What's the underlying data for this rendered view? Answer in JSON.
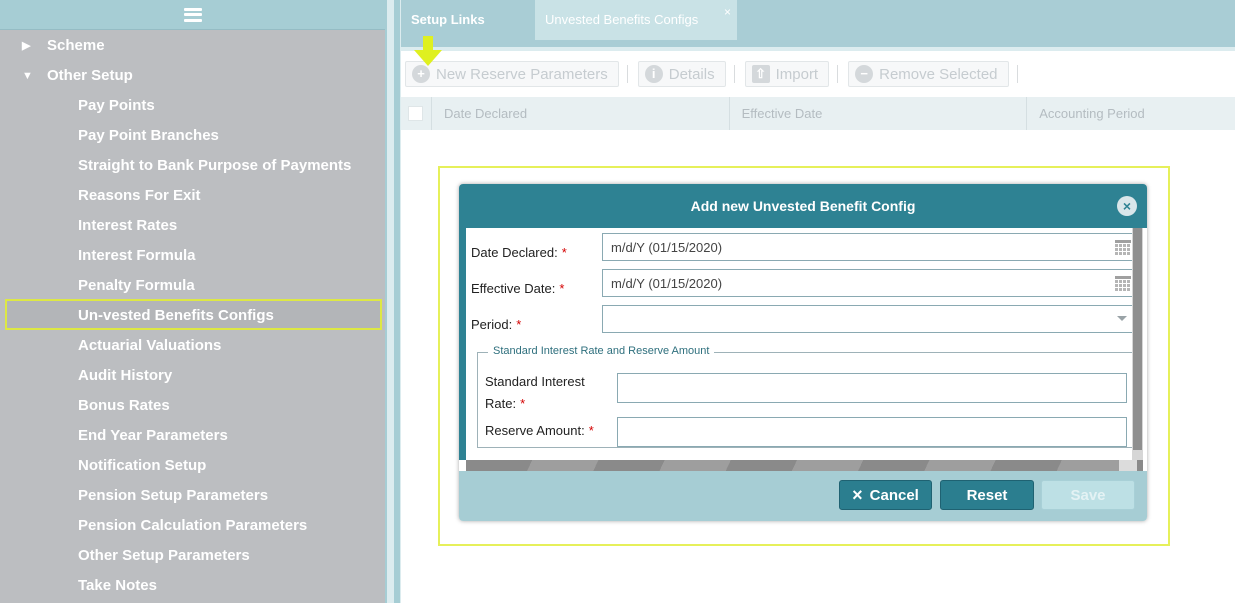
{
  "sidebar": {
    "groups": [
      {
        "label": "Scheme",
        "expanded": false
      },
      {
        "label": "Other Setup",
        "expanded": true
      }
    ],
    "items": [
      "Pay Points",
      "Pay Point Branches",
      "Straight to Bank Purpose of Payments",
      "Reasons For Exit",
      "Interest Rates",
      "Interest Formula",
      "Penalty Formula",
      "Un-vested Benefits Configs",
      "Actuarial Valuations",
      "Audit History",
      "Bonus Rates",
      "End Year Parameters",
      "Notification Setup",
      "Pension Setup Parameters",
      "Pension Calculation Parameters",
      "Other Setup Parameters",
      "Take Notes"
    ],
    "selected_item": "Un-vested Benefits Configs"
  },
  "tabs": [
    {
      "label": "Setup Links",
      "active": true
    },
    {
      "label": "Unvested Benefits Configs",
      "active": false,
      "close": "×"
    }
  ],
  "toolbar": {
    "new_label": "New Reserve Parameters",
    "details_label": "Details",
    "import_label": "Import",
    "remove_label": "Remove Selected"
  },
  "grid": {
    "columns": [
      "Date Declared",
      "Effective Date",
      "Accounting Period"
    ]
  },
  "modal": {
    "title": "Add new Unvested Benefit Config",
    "fields": {
      "date_declared_label": "Date Declared:",
      "date_declared_value": "m/d/Y (01/15/2020)",
      "effective_date_label": "Effective Date:",
      "effective_date_value": "m/d/Y (01/15/2020)",
      "period_label": "Period:",
      "period_value": ""
    },
    "fieldset_legend": "Standard Interest Rate and Reserve Amount",
    "std_rate_label_line1": "Standard Interest",
    "std_rate_label_line2": "Rate:",
    "std_rate_value": "",
    "reserve_amount_label": "Reserve Amount:",
    "reserve_amount_value": "",
    "required_mark": "*",
    "buttons": {
      "cancel": "Cancel",
      "cancel_icon": "×",
      "reset": "Reset",
      "save": "Save"
    }
  },
  "colors": {
    "accent": "#2e8293",
    "highlight": "#dde844",
    "sidebar_bg": "#bcbec1"
  }
}
